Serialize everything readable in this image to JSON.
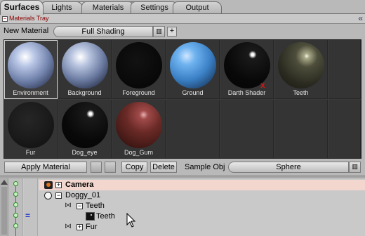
{
  "tabs": [
    "Surfaces",
    "Lights",
    "Materials",
    "Settings",
    "Output"
  ],
  "tray": {
    "title": "Materials Tray",
    "collapse_symbol": "−",
    "expand_symbol": "«"
  },
  "new_material": {
    "label": "New Material",
    "shading": "Full Shading",
    "menu_symbol": "▥",
    "add_symbol": "+"
  },
  "materials": [
    {
      "name": "Environment",
      "selected": true
    },
    {
      "name": "Background"
    },
    {
      "name": "Foreground"
    },
    {
      "name": "Ground"
    },
    {
      "name": "Darth Shader",
      "has_x": true,
      "x_symbol": "x"
    },
    {
      "name": "Teeth"
    },
    {
      "name": "Fur"
    },
    {
      "name": "Dog_eye"
    },
    {
      "name": "Dog_Gum"
    }
  ],
  "controls": {
    "apply": "Apply Material",
    "copy": "Copy",
    "delete": "Delete",
    "sample_label": "Sample Obj",
    "sample_value": "Sphere",
    "menu_symbol": "▥"
  },
  "tree": {
    "camera": "Camera",
    "object": "Doggy_01",
    "group": "Teeth",
    "material": "Teeth",
    "fur": "Fur",
    "minus_symbol": "−",
    "plus_symbol": "+",
    "eq_symbol": "="
  },
  "colors": {
    "accent_hl": "#f3d7ce",
    "error": "#e01010"
  }
}
